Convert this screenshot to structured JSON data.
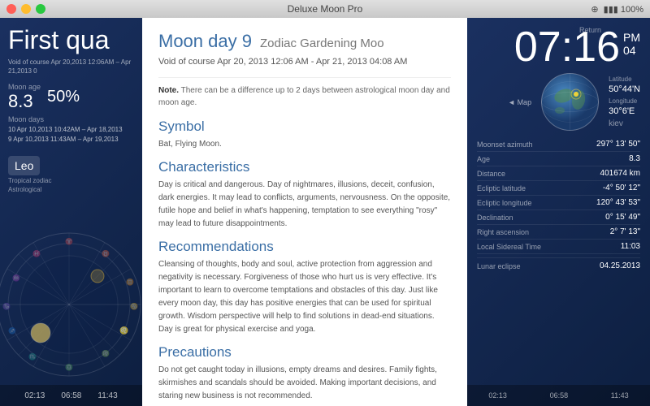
{
  "titlebar": {
    "title": "Deluxe Moon Pro"
  },
  "left": {
    "phase_title": "First qua",
    "void_text": "Void of course\nApr 20,2013 12:06AM – Apr 21,2013 0",
    "moon_age_label": "Moon age",
    "moon_age_value": "8.3",
    "moon_pct": "50%",
    "moon_days_label": "Moon days",
    "moon_day_1": "10  Apr 10,2013  10:42AM – Apr 18,2013",
    "moon_day_2": "9   Apr 10,2013  11:43AM – Apr 19,2013",
    "zodiac_sign": "Leo",
    "zodiac_sub": "Tropical zodiac",
    "zodiac_sub2": "Astrological",
    "bottom_times": [
      "02:13",
      "06:58",
      "11:43"
    ]
  },
  "modal": {
    "day_label": "Moon day 9",
    "subtitle": "Zodiac Gardening Moo",
    "void_line": "Void of course Apr 20, 2013 12:06 AM - Apr 21, 2013 04:08 AM",
    "note_bold": "Note.",
    "note_text": "There can be a difference up to 2 days between astrological moon day and moon age.",
    "symbol_title": "Symbol",
    "symbol_text": "Bat, Flying Moon.",
    "characteristics_title": "Characteristics",
    "characteristics_text": "Day is critical and dangerous. Day of nightmares, illusions, deceit, confusion, dark energies. It may lead to conflicts, arguments, nervousness. On the opposite, futile hope and belief in what's happening, temptation to see everything \"rosy\" may lead to future disappointments.",
    "recommendations_title": "Recommendations",
    "recommendations_text": "Cleansing of thoughts, body and soul, active protection from aggression and negativity is necessary. Forgiveness of those who hurt us is very effective. It's important to learn to overcome temptations and obstacles of this day. Just like every moon day, this day has positive energies that can be used for spiritual growth. Wisdom perspective will help to find solutions in dead-end situations. Day is great for physical exercise and yoga.",
    "precautions_title": "Precautions",
    "precautions_text": "Do not get caught today in illusions, empty dreams and desires. Family fights, skirmishes and scandals should be avoided. Making important decisions, and staring new business is not recommended."
  },
  "right": {
    "clock_time": "07:16",
    "clock_pm": "PM",
    "clock_date": "04",
    "return_label": "Return",
    "map_label": "◄ Map",
    "latitude": "50°44'N",
    "longitude": "30°6'E",
    "city": "kiev",
    "data": [
      {
        "key": "Moonset azimuth",
        "value": "297° 13' 50\""
      },
      {
        "key": "Age",
        "value": "8.3"
      },
      {
        "key": "Distance",
        "value": "401674 km"
      },
      {
        "key": "Ecliptic latitude",
        "value": "-4° 50' 12\""
      },
      {
        "key": "Ecliptic longitude",
        "value": "120° 43' 53\""
      },
      {
        "key": "Declination",
        "value": "0° 15' 49\""
      },
      {
        "key": "Right ascension",
        "value": "2° 7' 13\""
      },
      {
        "key": "Local Sidereal Time",
        "value": "11:03"
      }
    ],
    "lunar_eclipse": "04.25.2013",
    "lunar_eclipse_label": "Lunar eclipse",
    "bottom_items": [
      "02:13",
      "06:58",
      "11:43"
    ]
  }
}
